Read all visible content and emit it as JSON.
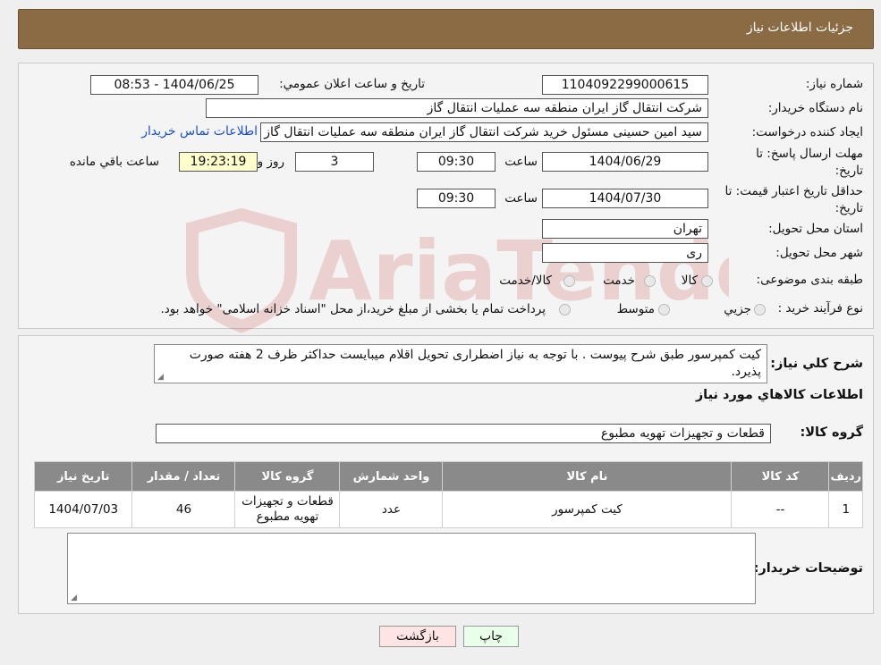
{
  "header": {
    "title": "جزئیات اطلاعات نیاز"
  },
  "form": {
    "need_number_label": "شماره نیاز:",
    "need_number": "1104092299000615",
    "announce_label": "تاریخ و ساعت اعلان عمومي:",
    "announce_value": "1404/06/25 - 08:53",
    "buyer_org_label": "نام دستگاه خریدار:",
    "buyer_org": "شرکت انتقال گاز ایران منطقه سه عملیات انتقال گاز",
    "requester_label": "ایجاد کننده درخواست:",
    "requester": "سید امین حسینی مسئول خرید شرکت انتقال گاز ایران منطقه سه عملیات انتقال گاز",
    "contact_link": "اطلاعات تماس خریدار",
    "deadline_label_1": "مهلت ارسال پاسخ: تا",
    "deadline_label_2": "تاریخ:",
    "deadline_date": "1404/06/29",
    "time_label": "ساعت",
    "deadline_time": "09:30",
    "days_value": "3",
    "days_label": "روز و",
    "remaining_value": "19:23:19",
    "remaining_label": "ساعت باقي مانده",
    "min_validity_label_1": "حداقل تاریخ اعتبار قیمت: تا",
    "min_validity_label_2": "تاریخ:",
    "validity_date": "1404/07/30",
    "validity_time": "09:30",
    "province_label": "استان محل تحویل:",
    "province": "تهران",
    "city_label": "شهر محل تحویل:",
    "city": "ری",
    "category_label": "طبقه بندی موضوعی:",
    "category_options": [
      "کالا",
      "خدمت",
      "کالا/خدمت"
    ],
    "process_label": "نوع فرآیند خرید :",
    "process_options": [
      "جزيي",
      "متوسط"
    ],
    "process_note": "پرداخت تمام یا بخشی از مبلغ خرید،از محل \"اسناد خزانه اسلامی\" خواهد بود."
  },
  "summary": {
    "label": "شرح کلي نياز:",
    "text": "کیت کمپرسور طبق شرح پیوست . با توجه به نیاز اضطراری تحویل اقلام میبایست حداکثر ظرف 2 هفته صورت پذیرد.",
    "goods_info_title": "اطلاعات کالاهاي مورد نياز",
    "goods_group_label": "گروه کالا:",
    "goods_group": "قطعات و تجهیزات تهویه مطبوع"
  },
  "table": {
    "headers": [
      "ردیف",
      "کد کالا",
      "نام کالا",
      "واحد شمارش",
      "گروه کالا",
      "تعداد / مقدار",
      "تاریخ نیاز"
    ],
    "rows": [
      [
        "1",
        "--",
        "کیت کمپرسور",
        "عدد",
        "قطعات و تجهیزات تهویه مطبوع",
        "46",
        "1404/07/03"
      ]
    ]
  },
  "buyer_notes": {
    "label": "توضیحات خریدار:",
    "text": ""
  },
  "buttons": {
    "print": "چاپ",
    "back": "بازگشت"
  },
  "watermark": {
    "text": "AriaTender.neT",
    "color": "#c0392b"
  }
}
